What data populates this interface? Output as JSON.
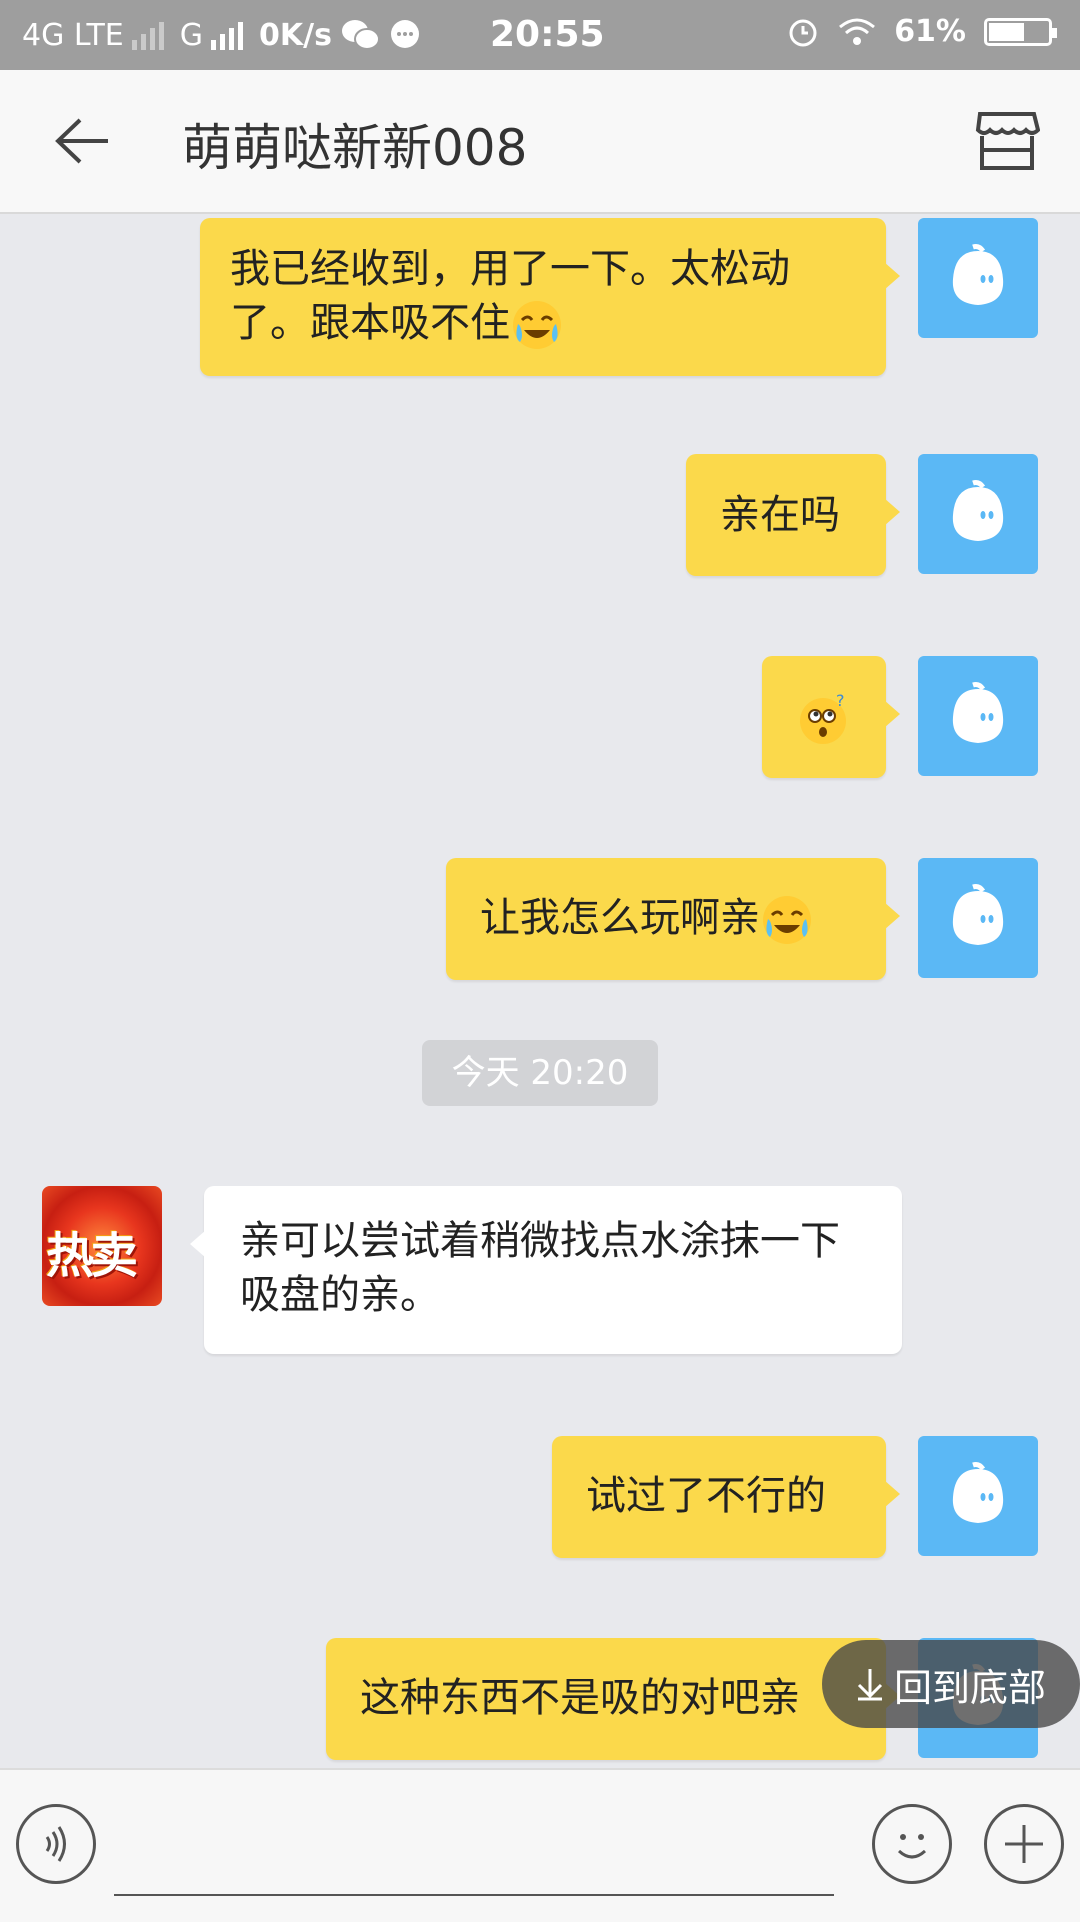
{
  "status_bar": {
    "network1": "4G LTE",
    "network2": "G",
    "speed": "0K/s",
    "time": "20:55",
    "battery": "61%",
    "battery_level": 0.61,
    "icons": [
      "wechat-icon",
      "message-icon",
      "alarm-icon",
      "wifi-icon",
      "battery-icon"
    ]
  },
  "header": {
    "title": "萌萌哒新新008",
    "back_icon": "back-arrow-icon",
    "shop_icon": "shop-icon"
  },
  "messages": [
    {
      "sender": "me",
      "text": "我已经收到，用了一下。太松动了。跟本吸不住",
      "emoji": "crying-laugh"
    },
    {
      "sender": "me",
      "text": "亲在吗"
    },
    {
      "sender": "me",
      "text": "",
      "emoji": "confused-face"
    },
    {
      "sender": "me",
      "text": "让我怎么玩啊亲",
      "emoji": "crying-laugh"
    },
    {
      "sender": "system",
      "text": "今天 20:20"
    },
    {
      "sender": "shop",
      "text": "亲可以尝试着稍微找点水涂抹一下吸盘的亲。",
      "avatar_text": "热卖"
    },
    {
      "sender": "me",
      "text": "试过了不行的"
    },
    {
      "sender": "me",
      "text": "这种东西不是吸的对吧亲"
    }
  ],
  "back_to_bottom": "回到底部",
  "input_bar": {
    "voice_icon": "voice-icon",
    "emoji_icon": "smiley-icon",
    "plus_icon": "plus-icon"
  },
  "colors": {
    "my_bubble": "#fbd94b",
    "my_avatar": "#5bb8f5",
    "background": "#e8e9ed",
    "status_bar": "#9e9e9e"
  }
}
